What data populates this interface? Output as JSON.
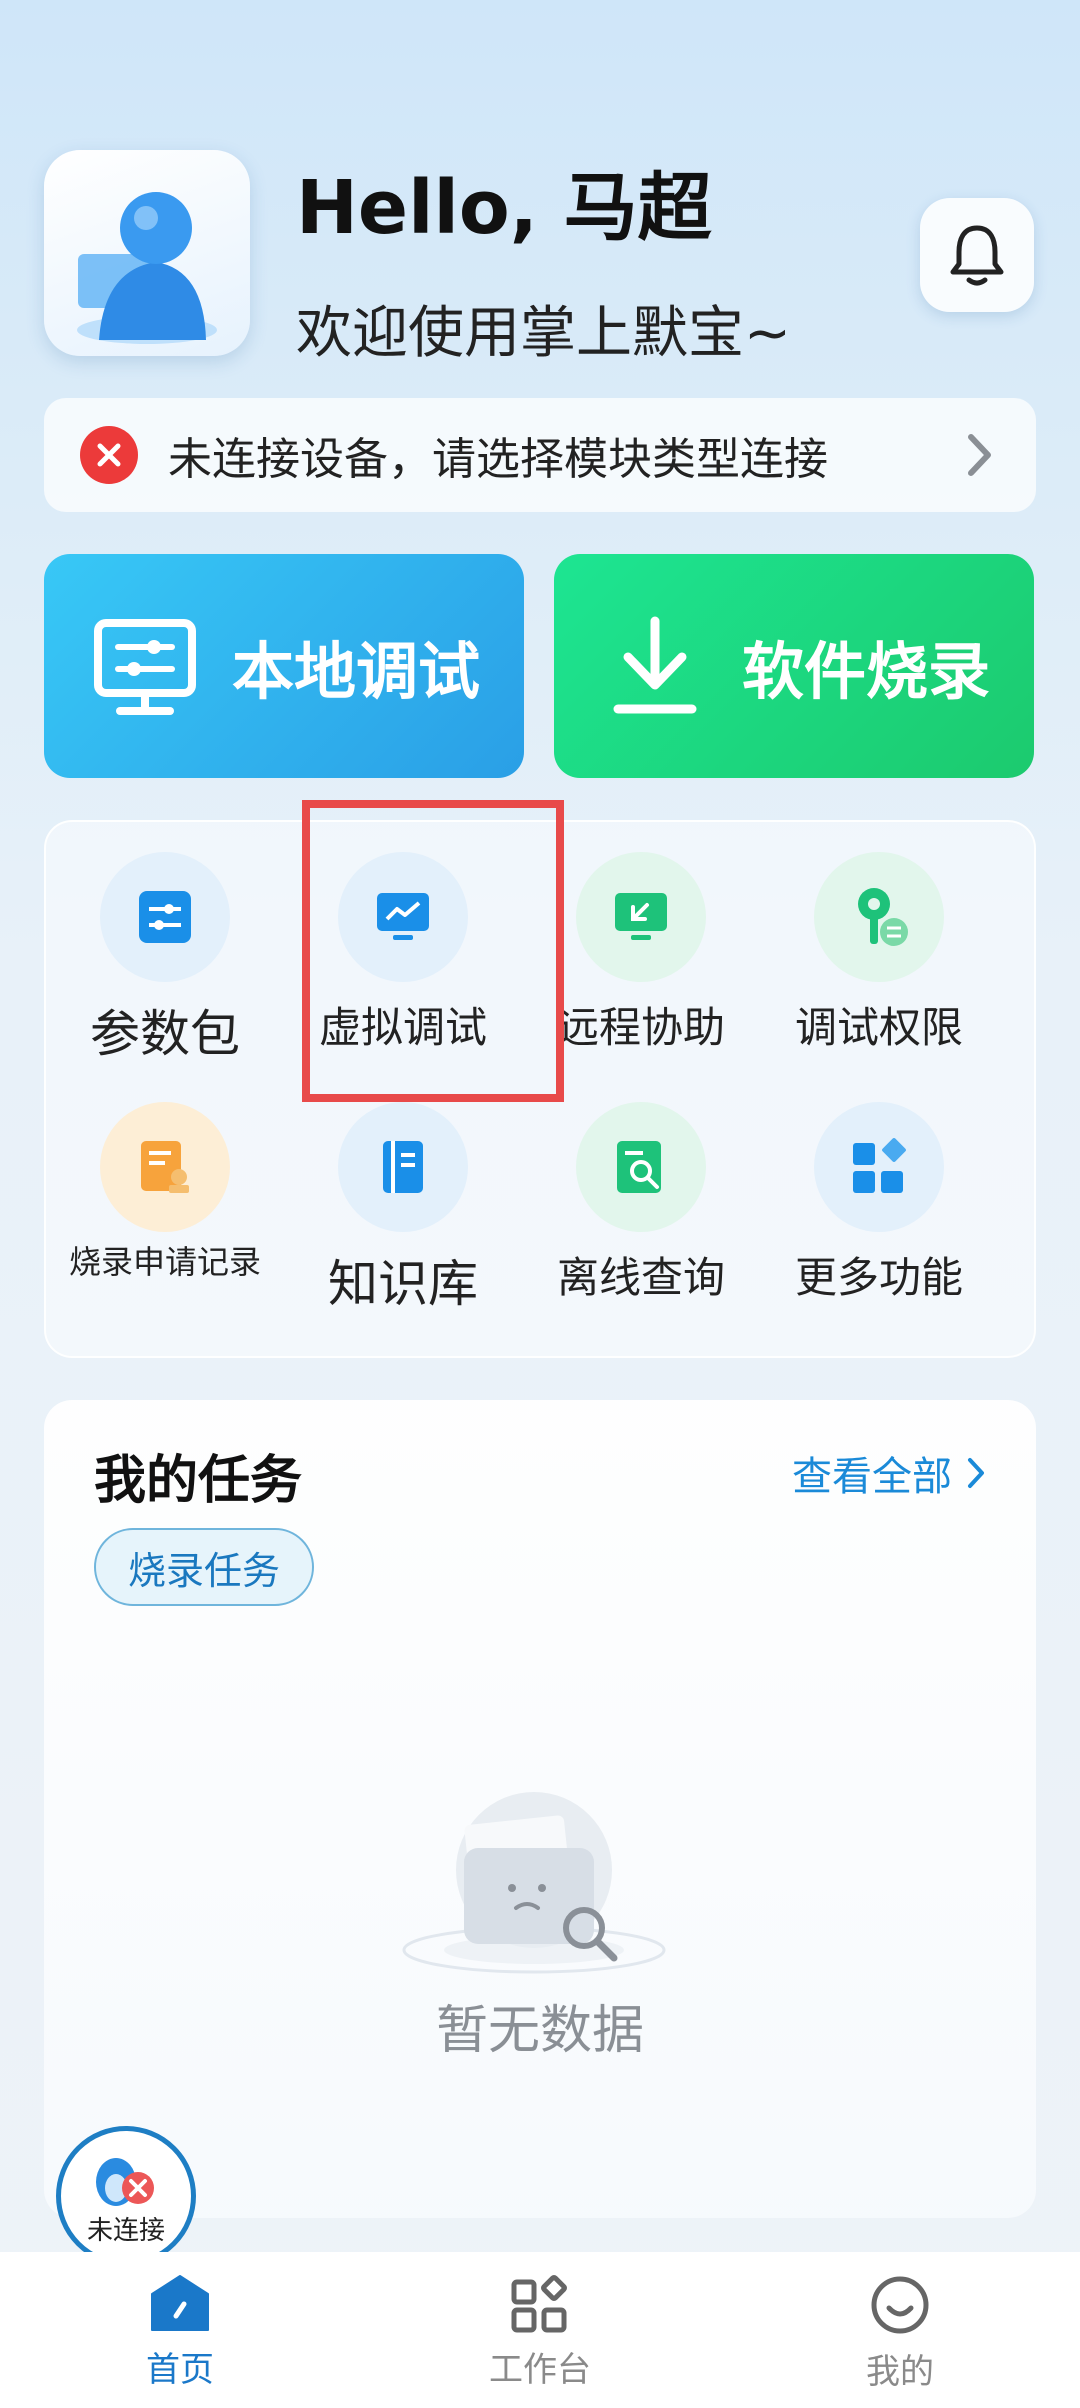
{
  "header": {
    "greeting": "Hello, 马超",
    "welcome": "欢迎使用掌上默宝~"
  },
  "status": {
    "message": "未连接设备，请选择模块类型连接",
    "color": "#ec3a3a"
  },
  "actions": {
    "local_debug": "本地调试",
    "software_burn": "软件烧录"
  },
  "features": [
    {
      "label": "参数包",
      "icon": "sliders-icon"
    },
    {
      "label": "虚拟调试",
      "icon": "monitor-chart-icon"
    },
    {
      "label": "远程协助",
      "icon": "remote-screen-icon"
    },
    {
      "label": "调试权限",
      "icon": "key-icon"
    },
    {
      "label": "烧录申请记录",
      "icon": "document-stamp-icon"
    },
    {
      "label": "知识库",
      "icon": "book-icon"
    },
    {
      "label": "离线查询",
      "icon": "search-document-icon"
    },
    {
      "label": "更多功能",
      "icon": "apps-icon"
    }
  ],
  "tasks": {
    "title": "我的任务",
    "view_all": "查看全部",
    "chip": "烧录任务",
    "empty": "暂无数据"
  },
  "connection_badge": {
    "label": "未连接"
  },
  "nav": {
    "home": "首页",
    "workbench": "工作台",
    "mine": "我的"
  },
  "colors": {
    "accent": "#1a78c9",
    "local_btn": "#2fb2ee",
    "burn_btn": "#1dd87f",
    "highlight_box": "#e84a4a"
  }
}
